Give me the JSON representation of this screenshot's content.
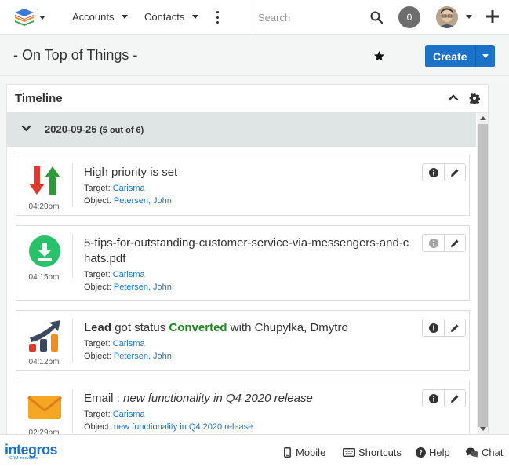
{
  "navbar": {
    "logo_icon": "stacked-layers-icon",
    "accounts_label": "Accounts",
    "contacts_label": "Contacts",
    "search_placeholder": "Search",
    "notification_count": "0"
  },
  "page": {
    "title": "- On Top of Things -",
    "create_label": "Create"
  },
  "timeline": {
    "title": "Timeline",
    "date": "2020-09-25",
    "count": "(5 out of 6)",
    "entries": [
      {
        "icon": "priority-arrows-icon",
        "time": "04:20pm",
        "title": "High priority is set",
        "target_label": "Target:",
        "target": "Carisma",
        "object_label": "Object:",
        "object": "Petersen, John"
      },
      {
        "icon": "download-circle-icon",
        "time": "04:15pm",
        "title": "5-tips-for-outstanding-customer-service-via-messengers-and-chats.pdf",
        "target_label": "Target:",
        "target": "Carisma",
        "object_label": "Object:",
        "object": "Petersen, John"
      },
      {
        "icon": "growth-chart-icon",
        "time": "04:12pm",
        "title_bold": "Lead",
        "title_mid": "got status",
        "title_status": "Converted",
        "title_end": "with Chupylka, Dmytro",
        "target_label": "Target:",
        "target": "Carisma",
        "object_label": "Object:",
        "object": "Petersen, John"
      },
      {
        "icon": "envelope-icon",
        "time": "02:29pm",
        "title_prefix": "Email :",
        "title_italic": "new functionality in Q4 2020 release",
        "target_label": "Target:",
        "target": "Carisma",
        "object_label": "Object:",
        "object": "new functionality in Q4 2020 release"
      }
    ]
  },
  "footer": {
    "logo_text": "integros",
    "logo_sub": "CRM innovators",
    "mobile_label": "Mobile",
    "shortcuts_label": "Shortcuts",
    "help_label": "Help",
    "chat_label": "Chat"
  },
  "colors": {
    "accent": "#1a73c8",
    "status_green": "#1f8a1f",
    "date_bar": "#dfe5e5"
  }
}
